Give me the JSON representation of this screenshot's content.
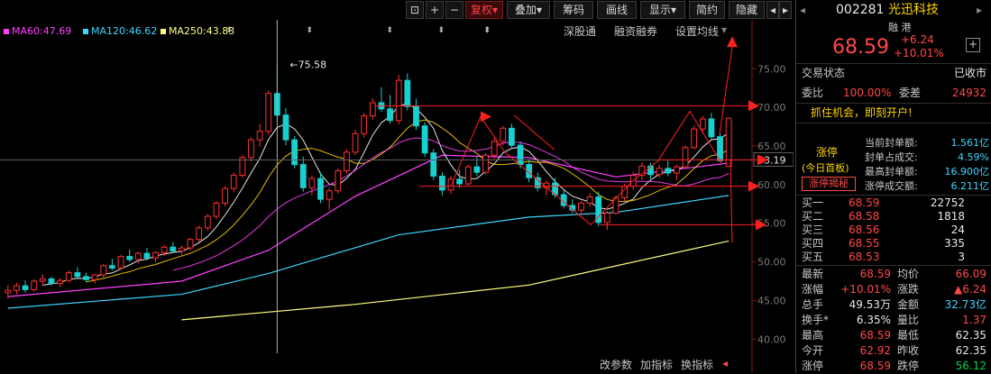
{
  "toolbar": {
    "buttons": [
      "复权",
      "叠加",
      "筹码",
      "画线",
      "显示",
      "简约",
      "隐藏"
    ],
    "nav_glyphs": [
      "◂",
      "▸"
    ]
  },
  "ma_legend": [
    {
      "label": "MA60:47.69",
      "color": "#ff40ff"
    },
    {
      "label": "MA120:46.62",
      "color": "#3cd6ff"
    },
    {
      "label": "MA250:43.83",
      "color": "#ffff80"
    }
  ],
  "chart_links": [
    "深股通",
    "融资融券",
    "设置均线"
  ],
  "bottom_links": [
    "改参数",
    "加指标",
    "换指标"
  ],
  "price_annotation": "75.58",
  "current_price_tag": "63.19",
  "y_axis_labels": [
    "75.00",
    "70.00",
    "65.00",
    "60.00",
    "55.00",
    "50.00",
    "45.00",
    "40.00"
  ],
  "chart_data": {
    "type": "candlestick",
    "ylim": [
      37,
      79
    ],
    "y_ticks": [
      75,
      70,
      65,
      60,
      55,
      50,
      45,
      40
    ],
    "candles": [
      [
        46.0,
        47.0,
        45.2,
        46.3
      ],
      [
        46.3,
        47.3,
        45.8,
        46.9
      ],
      [
        46.9,
        47.6,
        46.0,
        46.4
      ],
      [
        46.4,
        47.8,
        46.2,
        47.5
      ],
      [
        47.5,
        48.4,
        47.0,
        47.8
      ],
      [
        47.8,
        48.1,
        46.9,
        47.2
      ],
      [
        47.2,
        47.9,
        46.8,
        47.6
      ],
      [
        47.6,
        48.9,
        47.3,
        48.6
      ],
      [
        48.6,
        49.3,
        47.9,
        48.1
      ],
      [
        48.1,
        48.6,
        47.4,
        47.7
      ],
      [
        47.7,
        48.4,
        47.2,
        48.3
      ],
      [
        48.3,
        49.7,
        48.0,
        49.5
      ],
      [
        49.5,
        50.4,
        48.9,
        49.2
      ],
      [
        49.2,
        50.9,
        49.0,
        50.7
      ],
      [
        50.7,
        51.6,
        50.0,
        50.3
      ],
      [
        50.3,
        51.3,
        49.8,
        51.1
      ],
      [
        51.1,
        51.8,
        50.2,
        50.5
      ],
      [
        50.5,
        51.4,
        49.9,
        51.2
      ],
      [
        51.2,
        52.2,
        50.8,
        51.9
      ],
      [
        51.9,
        52.6,
        51.1,
        51.4
      ],
      [
        51.4,
        52.1,
        50.9,
        51.8
      ],
      [
        51.8,
        53.1,
        51.5,
        52.9
      ],
      [
        52.9,
        54.7,
        52.6,
        54.4
      ],
      [
        54.4,
        56.2,
        54.0,
        55.9
      ],
      [
        55.9,
        57.9,
        55.5,
        57.6
      ],
      [
        57.6,
        59.8,
        57.2,
        59.5
      ],
      [
        59.5,
        61.6,
        59.0,
        61.2
      ],
      [
        61.2,
        63.8,
        60.9,
        63.5
      ],
      [
        63.5,
        66.1,
        63.0,
        65.8
      ],
      [
        65.8,
        67.9,
        64.9,
        66.9
      ],
      [
        66.9,
        72.2,
        66.5,
        71.8
      ],
      [
        71.8,
        75.58,
        68.2,
        69.0
      ],
      [
        69.0,
        69.9,
        65.1,
        65.8
      ],
      [
        65.8,
        66.3,
        62.1,
        62.6
      ],
      [
        62.6,
        63.6,
        59.1,
        59.6
      ],
      [
        59.6,
        61.2,
        58.6,
        60.8
      ],
      [
        60.8,
        61.6,
        57.6,
        58.1
      ],
      [
        58.1,
        59.6,
        56.7,
        59.2
      ],
      [
        59.2,
        62.1,
        58.8,
        61.8
      ],
      [
        61.8,
        64.6,
        61.4,
        64.2
      ],
      [
        64.2,
        67.1,
        63.8,
        66.6
      ],
      [
        66.6,
        69.3,
        66.1,
        68.9
      ],
      [
        68.9,
        71.2,
        68.4,
        70.6
      ],
      [
        70.6,
        72.6,
        69.4,
        69.8
      ],
      [
        69.8,
        71.6,
        67.9,
        68.3
      ],
      [
        68.3,
        74.2,
        67.8,
        73.5
      ],
      [
        73.5,
        74.4,
        69.6,
        70.1
      ],
      [
        70.1,
        71.1,
        67.1,
        67.6
      ],
      [
        67.6,
        68.1,
        63.6,
        64.1
      ],
      [
        64.1,
        64.6,
        60.6,
        61.1
      ],
      [
        61.1,
        61.6,
        58.6,
        59.3
      ],
      [
        59.3,
        61.1,
        58.8,
        60.7
      ],
      [
        60.7,
        61.9,
        59.6,
        60.1
      ],
      [
        60.1,
        62.6,
        59.9,
        62.3
      ],
      [
        62.3,
        63.6,
        61.1,
        61.6
      ],
      [
        61.6,
        64.1,
        61.3,
        63.8
      ],
      [
        63.8,
        66.1,
        63.3,
        65.6
      ],
      [
        65.6,
        67.6,
        65.1,
        67.3
      ],
      [
        67.3,
        67.9,
        64.6,
        65.1
      ],
      [
        65.1,
        65.6,
        62.1,
        62.6
      ],
      [
        62.6,
        63.3,
        60.3,
        60.9
      ],
      [
        60.9,
        61.6,
        59.1,
        59.6
      ],
      [
        59.6,
        60.6,
        58.6,
        60.2
      ],
      [
        60.2,
        60.9,
        58.3,
        58.7
      ],
      [
        58.7,
        59.3,
        56.9,
        57.3
      ],
      [
        57.3,
        58.1,
        56.3,
        56.7
      ],
      [
        56.7,
        57.9,
        56.1,
        57.6
      ],
      [
        57.6,
        58.9,
        57.1,
        58.4
      ],
      [
        58.4,
        59.1,
        54.6,
        55.1
      ],
      [
        55.1,
        56.6,
        54.1,
        56.3
      ],
      [
        56.3,
        58.6,
        56.1,
        58.3
      ],
      [
        58.3,
        60.1,
        57.9,
        59.8
      ],
      [
        59.8,
        61.6,
        59.3,
        61.2
      ],
      [
        61.2,
        62.9,
        60.6,
        62.4
      ],
      [
        62.4,
        62.8,
        60.8,
        61.3
      ],
      [
        61.3,
        62.6,
        60.9,
        62.1
      ],
      [
        62.1,
        63.1,
        61.1,
        61.5
      ],
      [
        61.5,
        62.6,
        60.6,
        62.3
      ],
      [
        62.3,
        65.1,
        62.1,
        64.8
      ],
      [
        64.8,
        67.6,
        64.6,
        67.2
      ],
      [
        67.2,
        68.9,
        66.6,
        68.5
      ],
      [
        68.5,
        69.3,
        65.9,
        66.2
      ],
      [
        66.2,
        66.7,
        62.9,
        63.1
      ],
      [
        62.35,
        68.59,
        62.35,
        68.59
      ]
    ],
    "ma_lines": [
      {
        "name": "MA60",
        "color": "#ff40ff",
        "points": [
          [
            0,
            45.5
          ],
          [
            20,
            47.5
          ],
          [
            30,
            51.5
          ],
          [
            40,
            58.5
          ],
          [
            50,
            63.8
          ],
          [
            60,
            63.5
          ],
          [
            70,
            61.0
          ],
          [
            83,
            62.8
          ]
        ]
      },
      {
        "name": "MA120",
        "color": "#3cd6ff",
        "points": [
          [
            0,
            44.0
          ],
          [
            20,
            45.8
          ],
          [
            30,
            48.5
          ],
          [
            45,
            53.5
          ],
          [
            60,
            55.8
          ],
          [
            70,
            56.4
          ],
          [
            83,
            58.6
          ]
        ]
      },
      {
        "name": "MA250",
        "color": "#ffff80",
        "points": [
          [
            20,
            42.5
          ],
          [
            40,
            44.5
          ],
          [
            60,
            47.0
          ],
          [
            83,
            52.7
          ]
        ]
      }
    ]
  },
  "quote": {
    "code": "002281",
    "name": "光迅科技",
    "tags": "融 港",
    "price": "68.59",
    "change": "+6.24",
    "change_pct": "+10.01%",
    "status_label": "交易状态",
    "status_value": "已收市",
    "weibi_label": "委比",
    "weibi_value": "100.00%",
    "weicha_label": "委差",
    "weicha_value": "24932",
    "promo": "抓住机会，即刻开户!",
    "limit_up": "涨停",
    "limit_up_sub": "(今日首板)",
    "limit_up_btn": "涨停揭秘",
    "seal_stats": [
      {
        "label": "当前封单额:",
        "value": "1.561亿"
      },
      {
        "label": "封单占成交:",
        "value": "4.59%"
      },
      {
        "label": "最高封单额:",
        "value": "16.900亿"
      },
      {
        "label": "涨停成交额:",
        "value": "6.211亿"
      }
    ],
    "bids": [
      {
        "label": "买一",
        "price": "68.59",
        "vol": "22752"
      },
      {
        "label": "买二",
        "price": "68.58",
        "vol": "1818"
      },
      {
        "label": "买三",
        "price": "68.56",
        "vol": "24"
      },
      {
        "label": "买四",
        "price": "68.55",
        "vol": "335"
      },
      {
        "label": "买五",
        "price": "68.53",
        "vol": "3"
      }
    ],
    "stats": [
      {
        "l1": "最新",
        "v1": "68.59",
        "c1": "red",
        "l2": "均价",
        "v2": "66.09",
        "c2": "red"
      },
      {
        "l1": "涨幅",
        "v1": "+10.01%",
        "c1": "red",
        "l2": "涨跌",
        "v2": "▲6.24",
        "c2": "red"
      },
      {
        "l1": "总手",
        "v1": "49.53万",
        "c1": "white",
        "l2": "金额",
        "v2": "32.73亿",
        "c2": "cyan"
      },
      {
        "l1": "换手*",
        "v1": "6.35%",
        "c1": "white",
        "l2": "量比",
        "v2": "1.37",
        "c2": "red"
      },
      {
        "l1": "最高",
        "v1": "68.59",
        "c1": "red",
        "l2": "最低",
        "v2": "62.35",
        "c2": "white"
      },
      {
        "l1": "今开",
        "v1": "62.92",
        "c1": "red",
        "l2": "昨收",
        "v2": "62.35",
        "c2": "white"
      },
      {
        "l1": "涨停",
        "v1": "68.59",
        "c1": "red",
        "l2": "跌停",
        "v2": "56.12",
        "c2": "green"
      }
    ]
  }
}
